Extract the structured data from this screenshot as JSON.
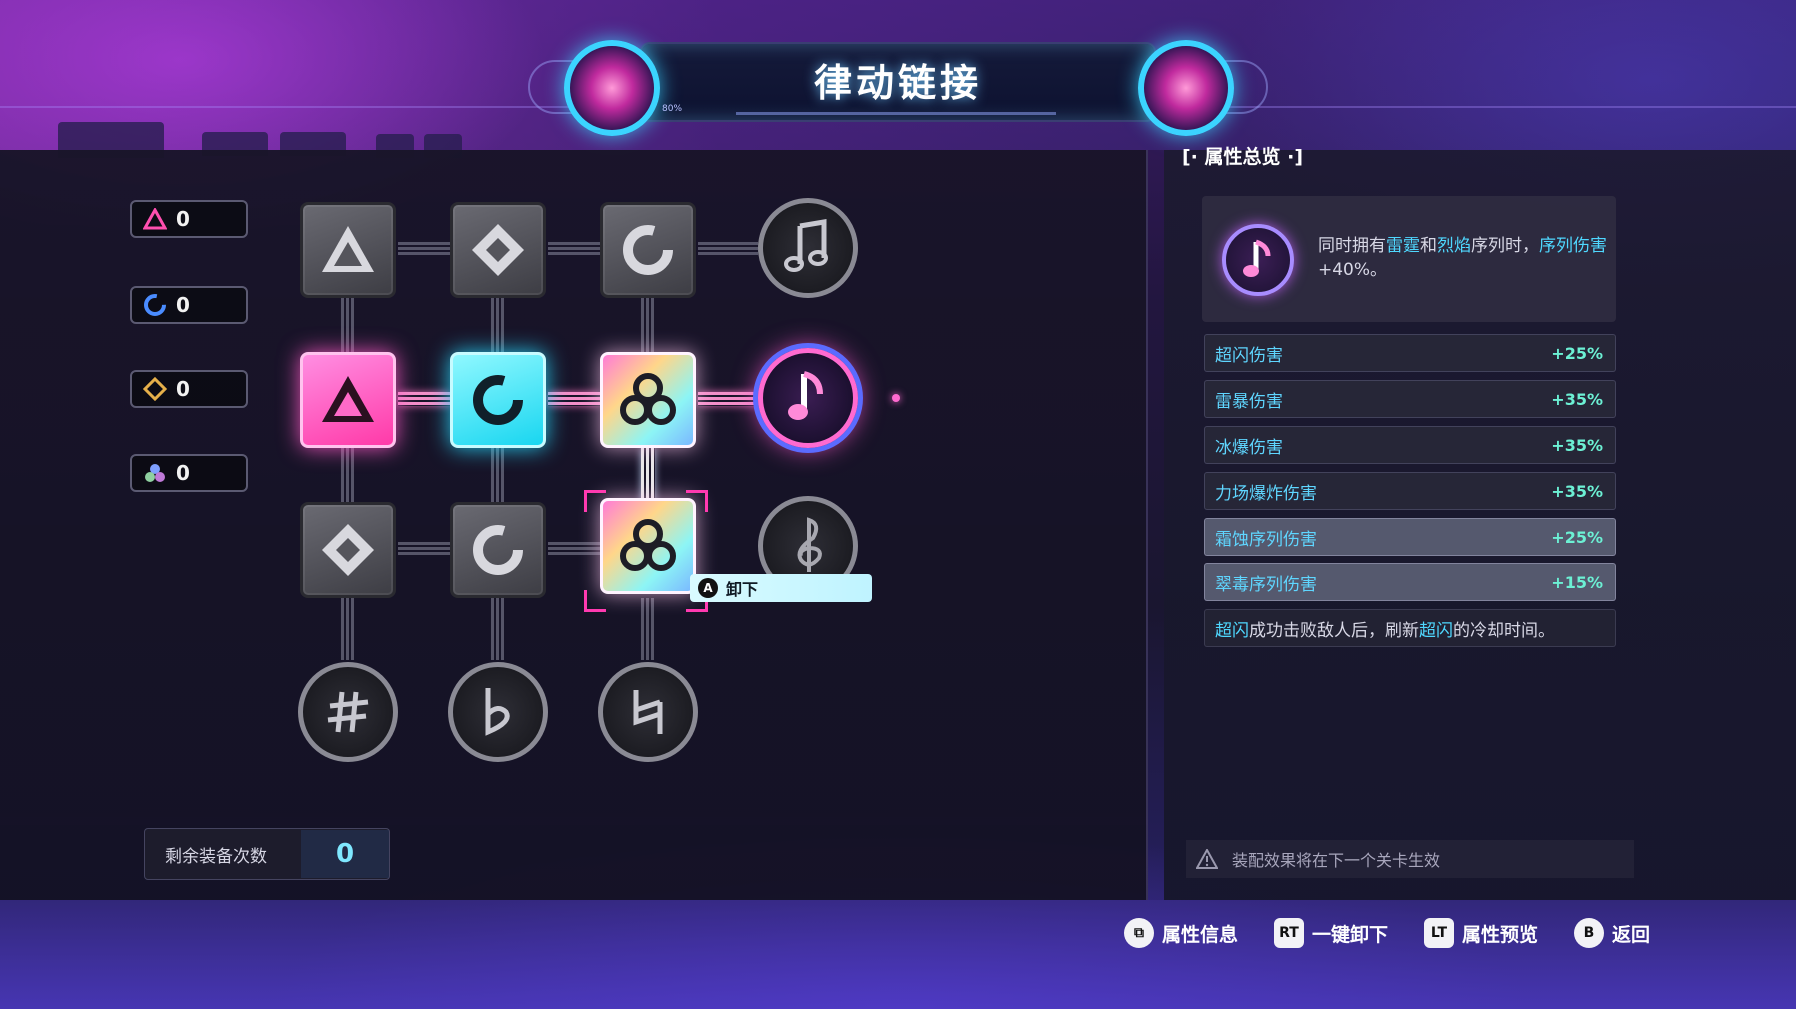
{
  "header": {
    "title": "律动链接",
    "sub_left": "80%"
  },
  "resources": [
    {
      "icon": "triangle-icon",
      "count": "0",
      "color": "#ff4fb0"
    },
    {
      "icon": "ring-icon",
      "count": "0",
      "color": "#4a8cff"
    },
    {
      "icon": "diamond-icon",
      "count": "0",
      "color": "#e6b04a"
    },
    {
      "icon": "trefoil-icon",
      "count": "0",
      "color": "#8fd0a0"
    }
  ],
  "grid": {
    "tooltip_key": "A",
    "tooltip_label": "卸下",
    "symbols": {
      "row1": "music-note-icon",
      "row2": "music-note-icon",
      "row3": "treble-clef-icon",
      "row4": [
        "sharp-icon",
        "flat-icon",
        "natural-icon"
      ]
    }
  },
  "remaining": {
    "label": "剩余装备次数",
    "value": "0"
  },
  "overview": {
    "title": "[· 属性总览 ·]",
    "desc_parts": [
      "同时拥有",
      "雷霆",
      "和",
      "烈焰",
      "序列时，",
      "序列伤害",
      "+40%。"
    ],
    "stats": [
      {
        "name": "超闪伤害",
        "value": "+25%"
      },
      {
        "name": "雷暴伤害",
        "value": "+35%"
      },
      {
        "name": "冰爆伤害",
        "value": "+35%"
      },
      {
        "name": "力场爆炸伤害",
        "value": "+35%"
      },
      {
        "name": "霜蚀序列伤害",
        "value": "+25%"
      },
      {
        "name": "翠毒序列伤害",
        "value": "+15%"
      }
    ],
    "effect_parts": [
      "超闪",
      "成功击败敌人后，刷新",
      "超闪",
      "的冷却时间。"
    ],
    "notice": "装配效果将在下一个关卡生效"
  },
  "footer": {
    "hints": [
      {
        "key": "⧉",
        "label": "属性信息"
      },
      {
        "key": "RT",
        "label": "一键卸下"
      },
      {
        "key": "LT",
        "label": "属性预览"
      },
      {
        "key": "B",
        "label": "返回"
      }
    ]
  },
  "colors": {
    "accent_cyan": "#4fd8ff",
    "accent_pink": "#ff4fb0",
    "stat_value": "#6cf0d4"
  }
}
